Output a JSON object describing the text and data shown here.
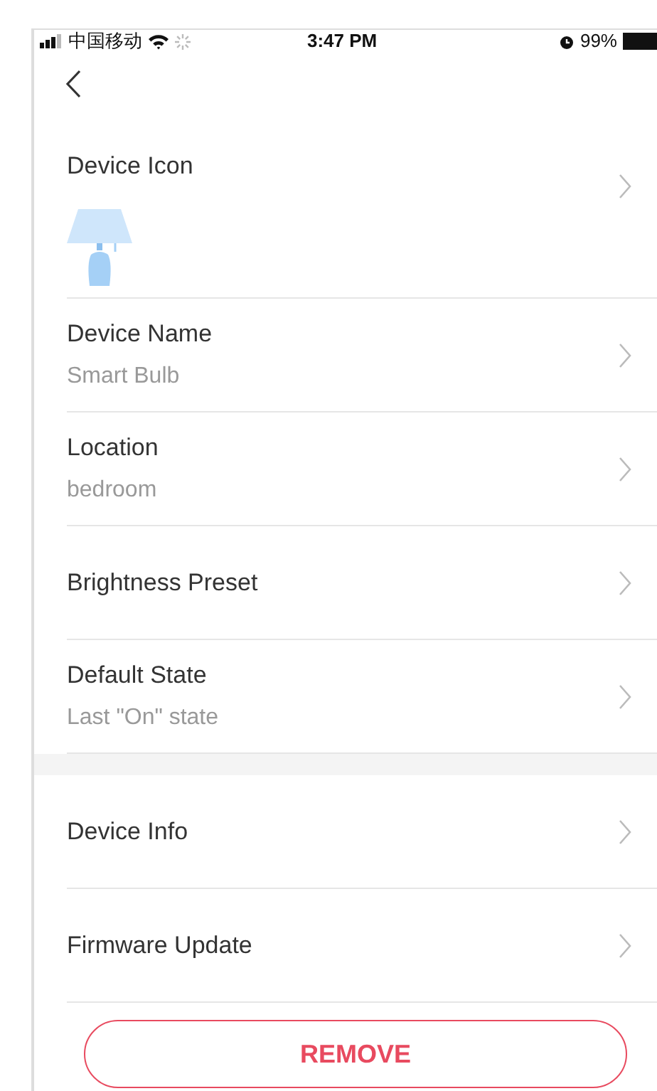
{
  "status_bar": {
    "carrier": "中国移动",
    "time": "3:47 PM",
    "battery": "99%"
  },
  "sections": [
    {
      "rows": [
        {
          "kind": "icon",
          "label": "Device Icon"
        },
        {
          "kind": "value",
          "label": "Device Name",
          "value": "Smart Bulb"
        },
        {
          "kind": "value",
          "label": "Location",
          "value": "bedroom"
        },
        {
          "kind": "plain",
          "label": "Brightness Preset"
        },
        {
          "kind": "value",
          "label": "Default State",
          "value": "Last \"On\" state"
        }
      ]
    },
    {
      "rows": [
        {
          "kind": "plain",
          "label": "Device Info"
        },
        {
          "kind": "plain",
          "label": "Firmware Update"
        }
      ]
    }
  ],
  "remove_button": "REMOVE"
}
